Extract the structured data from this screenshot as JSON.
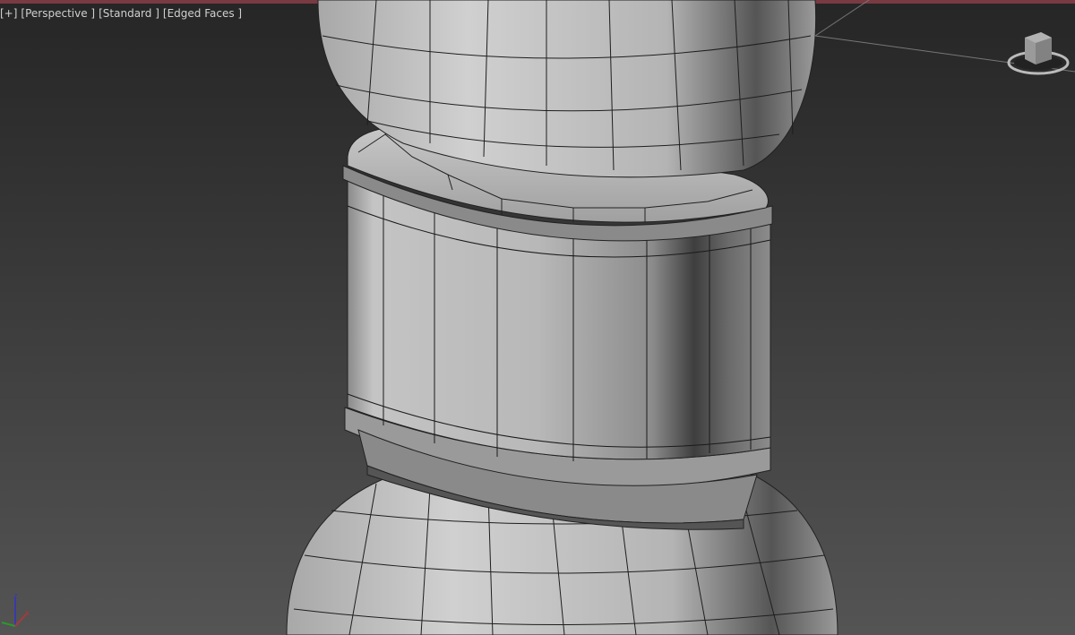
{
  "viewport": {
    "labels": {
      "menu": "[+]",
      "view": "[Perspective ]",
      "shading": "[Standard ]",
      "display": "[Edged Faces ]"
    },
    "active_border_color": "#7a3a42",
    "viewcube_icon": "viewcube-icon",
    "axis_icon": "axis-tripod-icon"
  }
}
